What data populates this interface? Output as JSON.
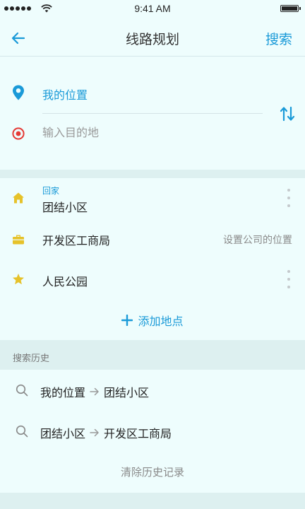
{
  "status_bar": {
    "time": "9:41 AM"
  },
  "nav": {
    "title": "线路规划",
    "search_label": "搜索"
  },
  "route": {
    "origin": "我的位置",
    "destination_placeholder": "输入目的地",
    "destination_value": ""
  },
  "places": {
    "home": {
      "tag": "回家",
      "name": "团结小区"
    },
    "work": {
      "name": "开发区工商局",
      "hint": "设置公司的位置"
    },
    "favorite": {
      "name": "人民公园"
    },
    "add_label": "添加地点"
  },
  "history": {
    "header": "搜索历史",
    "items": [
      {
        "from": "我的位置",
        "to": "团结小区"
      },
      {
        "from": "团结小区",
        "to": "开发区工商局"
      }
    ],
    "clear_label": "清除历史记录"
  },
  "colors": {
    "accent": "#1a9ad8",
    "home_icon": "#e6c22a",
    "work_icon": "#e6c22a",
    "favorite_icon": "#e6c22a",
    "destination_icon": "#e53935",
    "background": "#eefdfd",
    "band": "#ddf0f0"
  },
  "icons": {
    "back": "arrow-left-icon",
    "origin": "location-pin-icon",
    "destination": "target-icon",
    "swap": "swap-vertical-icon",
    "home": "home-icon",
    "work": "briefcase-icon",
    "favorite": "star-icon",
    "add": "plus-icon",
    "history": "search-icon",
    "more": "more-vertical-icon"
  }
}
